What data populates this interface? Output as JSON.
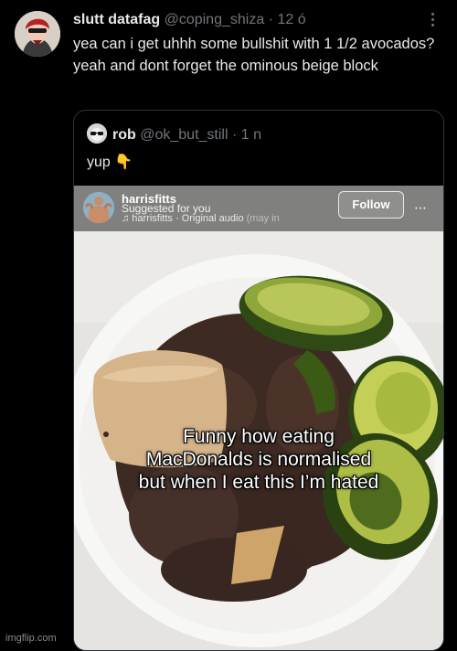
{
  "tweet": {
    "display_name": "slutt datafag",
    "handle": "@coping_shiza",
    "separator": "·",
    "time": "12 ó",
    "text": "yea can i get uhhh some bullshit with 1 1/2 avocados? yeah and dont forget the ominous beige block"
  },
  "quote": {
    "display_name": "rob",
    "handle": "@ok_but_still",
    "separator": "·",
    "time": "1 n",
    "text": "yup 👇"
  },
  "media": {
    "ig_username": "harrisfitts",
    "ig_suggested": "Suggested for you",
    "ig_audio": "♫ harrisfitts · Original audio",
    "ig_audio_faint": "(may in",
    "follow_label": "Follow",
    "more_icon": "⋯",
    "caption_lines": [
      "Funny how eating",
      "MacDonalds is normalised",
      "but when I eat this I’m hated"
    ]
  },
  "watermark": "imgflip.com"
}
